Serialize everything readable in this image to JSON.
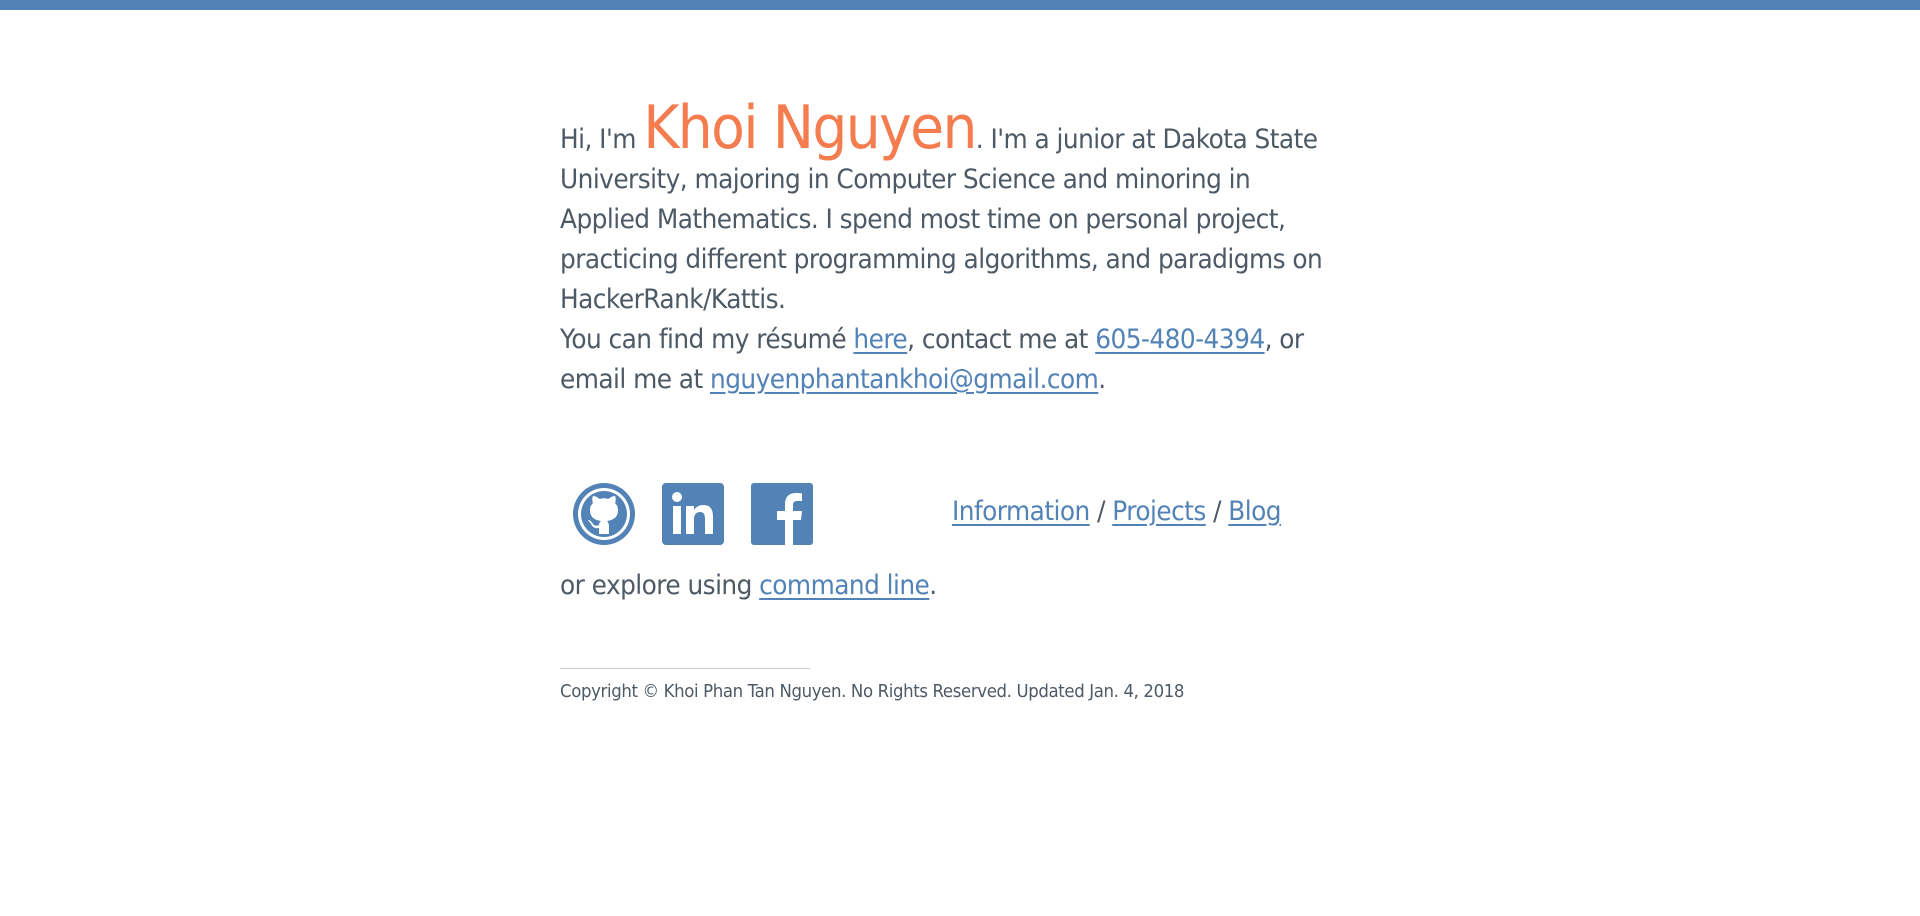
{
  "colors": {
    "accent": "#5383b6",
    "name": "#f47c4f",
    "text": "#4d5a66"
  },
  "intro": {
    "greeting": "Hi, I'm ",
    "name": "Khoi Nguyen",
    "bio": ". I'm a junior at Dakota State University, majoring in Computer Science and minoring in Applied Mathematics. I spend most time on personal project, practicing different programming algorithms, and paradigms on HackerRank/Kattis.",
    "resume_prefix": "You can find my résumé ",
    "resume_link": "here",
    "contact_prefix": ", contact me at ",
    "phone": "605-480-4394",
    "email_prefix": ", or email me at ",
    "email": "nguyenphantankhoi@gmail.com",
    "end": "."
  },
  "social": [
    {
      "icon": "github-icon"
    },
    {
      "icon": "linkedin-icon"
    },
    {
      "icon": "facebook-icon"
    }
  ],
  "nav": {
    "information": "Information",
    "sep1": " / ",
    "projects": "Projects",
    "sep2": " / ",
    "blog": "Blog"
  },
  "explore": {
    "prefix": "or explore using ",
    "link": "command line",
    "end": "."
  },
  "footer": {
    "copyright": "Copyright © Khoi Phan Tan Nguyen. No Rights Reserved. Updated Jan. 4, 2018"
  }
}
